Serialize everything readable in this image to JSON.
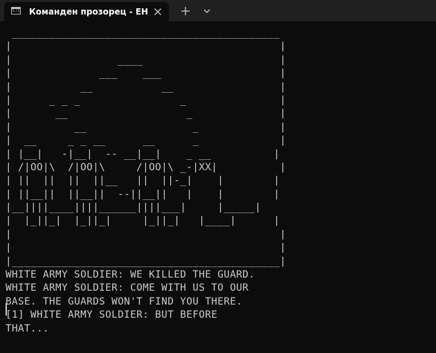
{
  "window": {
    "tab_title": "Команден прозорец - EHS-W",
    "icons": {
      "app": "terminal-app-icon",
      "close": "close-icon",
      "new_tab": "plus-icon",
      "dropdown": "chevron-down-icon"
    },
    "colors": {
      "titlebar": "#202020",
      "background": "#0c0c0c",
      "text": "#cccccc"
    }
  },
  "terminal": {
    "lines": [
      " ___________________________________________",
      "|                                           |",
      "|                 ____                      |",
      "|              ___    ___                   |",
      "|           __           __                 |",
      "|      _ _ _                _               |",
      "|       __                   _              |",
      "|          __                 _             |",
      "|  __     _ _ __      __      _             |",
      "| |__|   -|__|  -- __|__|    _ __          |",
      "| /|OO|\\  /|OO|\\     /|OO|\\ _-|XX|          |",
      "| ||  ||  ||  ||__   ||  ||-_|    |        |",
      "| ||__||  ||__||  --||__||   |    |        |",
      "|__||||____||||______||||___|     |_____|",
      "|  |_||_|  |_||_|     |_||_|   |____|      |",
      "|                                           |",
      "|                                           |",
      "|___________________________________________|",
      "WHITE ARMY SOLDIER: WE KILLED THE GUARD.",
      "WHITE ARMY SOLDIER: COME WITH US TO OUR",
      "BASE. THE GUARDS WON'T FIND YOU THERE.",
      "[1] WHITE ARMY SOLDIER: BUT BEFORE",
      "THAT..."
    ]
  }
}
